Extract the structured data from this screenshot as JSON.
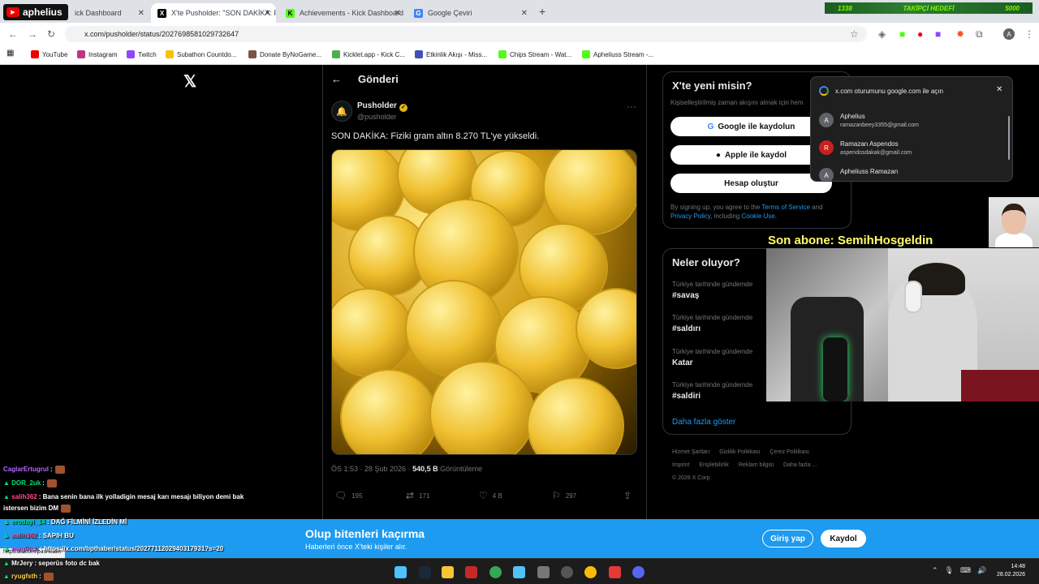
{
  "stream": {
    "logo_text": "aphelius",
    "follow_left": "1338",
    "follow_label": "TAKİPÇİ HEDEFİ",
    "follow_right": "5000",
    "sub_alert": "Son abone: SemihHosgeldin"
  },
  "browser": {
    "tabs": [
      {
        "label": "ick Dashboard",
        "icon": "kick-icon"
      },
      {
        "label": "X'te Pusholder: \"SON DAKİKA: F",
        "icon": "x-icon"
      },
      {
        "label": "Achievements - Kick Dashboard",
        "icon": "kick-icon"
      },
      {
        "label": "Google Çeviri",
        "icon": "google-translate-icon"
      }
    ],
    "url": "x.com/pusholder/status/2027698581029732647",
    "bookmarks": [
      "YouTube",
      "Instagram",
      "Twitch",
      "Subathon Countdo...",
      "Donate ByNoGame...",
      "Kicklet.app - Kick C...",
      "Etkinlik Akışı - Miss...",
      "Chips Stream - Wat...",
      "Apheliuss Stream -..."
    ],
    "hover_url": "https://x.com/pusholder"
  },
  "post": {
    "header": "Gönderi",
    "author_name": "Pusholder",
    "author_handle": "@pusholder",
    "text": "SON DAKİKA: Fiziki gram altın 8.270 TL'ye yükseldi.",
    "time": "ÖS 1:53 · 28 Şub 2026 · ",
    "views_count": "540,5 B",
    "views_label": " Görüntüleme",
    "replies": "195",
    "reposts": "171",
    "likes": "4 B",
    "bookmarks": "297"
  },
  "sidebar": {
    "new_title": "X'te yeni misin?",
    "new_sub": "Kişiselleştirilmiş zaman akışını almak için hem",
    "google_btn": "Google ile kaydolun",
    "apple_btn": "Apple ile kaydol",
    "create_btn": "Hesap oluştur",
    "terms_1": "By signing up, you agree to the ",
    "terms_link1": "Terms of Service",
    "terms_2": " and ",
    "terms_link2": "Privacy Policy",
    "terms_3": ", including ",
    "terms_link3": "Cookie Use.",
    "trends_title": "Neler oluyor?",
    "trends": [
      {
        "sub": "Türkiye tarihinde gündemde",
        "tag": "#savaş"
      },
      {
        "sub": "Türkiye tarihinde gündemde",
        "tag": "#saldırı"
      },
      {
        "sub": "Türkiye tarihinde gündemde",
        "tag": "Katar"
      },
      {
        "sub": "Türkiye tarihinde gündemde",
        "tag": "#saldiri"
      }
    ],
    "show_more": "Daha fazla göster",
    "footer": [
      "Hizmet Şartları",
      "Gizlilik Politikası",
      "Çerez Politikası",
      "Imprint",
      "Erişilebilirlik",
      "Reklam bilgisi",
      "Daha fazla ...",
      "© 2026 X Corp."
    ]
  },
  "google_popup": {
    "title": "x.com oturumunu google.com ile açın",
    "accounts": [
      {
        "initial": "A",
        "name": "Aphelius",
        "email": "ramazanbeey3355@gmail.com",
        "color": "#5f6368"
      },
      {
        "initial": "R",
        "name": "Ramazan Aspendos",
        "email": "aspendosdakak@gmail.com",
        "color": "#c5221f"
      },
      {
        "initial": "A",
        "name": "Apheliuss Ramazan",
        "email": "",
        "color": "#5f6368"
      }
    ]
  },
  "chat": [
    {
      "user": "CaglarErtugrul",
      "color": "#b565ff",
      "msg": ":"
    },
    {
      "user": "DOR_2uk",
      "color": "#00e676",
      "msg": ":"
    },
    {
      "user": "salih362",
      "color": "#ff4d8d",
      "msg": ": Bana senin bana ilk yolladigin mesaj karı mesajı biliyon demi bak"
    },
    {
      "user": "",
      "color": "#fff",
      "msg": "istersen bizim DM"
    },
    {
      "user": "erodayi_14",
      "color": "#00e676",
      "msg": ": DAĞ FİLMİNİ İZLEDİN Mİ"
    },
    {
      "user": "salih362",
      "color": "#ff4d8d",
      "msg": ": SAPIH BU"
    },
    {
      "user": "myglitch",
      "color": "#b565ff",
      "msg": ": https://x.com/bpthaber/status/2027711202940317931?s=20"
    },
    {
      "user": "MrJery",
      "color": "#ffffff",
      "msg": ": seperüs foto dc bak"
    },
    {
      "user": "ryugfsth",
      "color": "#ffd54f",
      "msg": ":"
    }
  ],
  "banner": {
    "title": "Olup bitenleri kaçırma",
    "subtitle": "Haberleri önce X'teki kişiler alır.",
    "login": "Giriş yap",
    "signup": "Kaydol"
  },
  "taskbar": {
    "time": "14:48",
    "date": "28.02.2026"
  }
}
